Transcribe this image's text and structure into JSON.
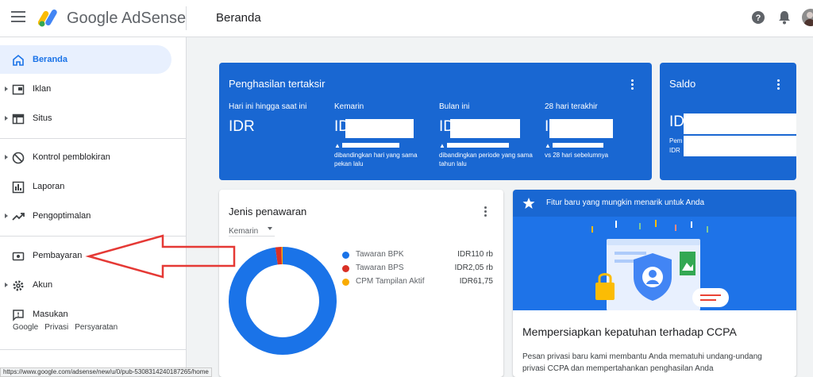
{
  "header": {
    "brand": "Google AdSense",
    "page_title": "Beranda"
  },
  "sidebar": {
    "items": [
      {
        "label": "Beranda",
        "icon": "home-icon"
      },
      {
        "label": "Iklan",
        "icon": "ad-unit-icon"
      },
      {
        "label": "Situs",
        "icon": "web-icon"
      },
      {
        "label": "Kontrol pemblokiran",
        "icon": "block-icon"
      },
      {
        "label": "Laporan",
        "icon": "bar-chart-icon"
      },
      {
        "label": "Pengoptimalan",
        "icon": "trending-up-icon"
      },
      {
        "label": "Pembayaran",
        "icon": "payment-icon"
      },
      {
        "label": "Akun",
        "icon": "gear-icon"
      },
      {
        "label": "Masukan",
        "icon": "feedback-icon"
      }
    ],
    "footer": [
      "Google",
      "Privasi",
      "Persyaratan"
    ]
  },
  "status_url": "https://www.google.com/adsense/new/u/0/pub-5308314240187265/home",
  "earnings": {
    "title": "Penghasilan tertaksir",
    "metrics": [
      {
        "label": "Hari ini hingga saat ini",
        "value": "IDR",
        "sub": ""
      },
      {
        "label": "Kemarin",
        "value": "ID",
        "sub": "dibandingkan hari yang sama pekan lalu"
      },
      {
        "label": "Bulan ini",
        "value": "ID",
        "sub": "dibandingkan periode yang sama tahun lalu"
      },
      {
        "label": "28 hari terakhir",
        "value": "I",
        "sub": "vs 28 hari sebelumnya"
      }
    ]
  },
  "balance": {
    "title": "Saldo",
    "value": "ID",
    "sub1": "Pem",
    "sub2": "IDR"
  },
  "offers": {
    "title": "Jenis penawaran",
    "period": "Kemarin",
    "legend": [
      {
        "name": "Tawaran BPK",
        "value": "IDR110 rb",
        "color": "#1a73e8"
      },
      {
        "name": "Tawaran BPS",
        "value": "IDR2,05 rb",
        "color": "#d93025"
      },
      {
        "name": "CPM Tampilan Aktif",
        "value": "IDR61,75",
        "color": "#f9ab00"
      }
    ],
    "shares": [
      0.9773,
      0.0182,
      0.0045
    ]
  },
  "feature": {
    "banner": "Fitur baru yang mungkin menarik untuk Anda",
    "title": "Mempersiapkan kepatuhan terhadap CCPA",
    "body": "Pesan privasi baru kami membantu Anda mematuhi undang-undang privasi CCPA dan mempertahankan penghasilan Anda"
  },
  "colors": {
    "primary_blue": "#1967d2",
    "active_nav_bg": "#e8f0fe",
    "annotation_red": "#e53935"
  }
}
